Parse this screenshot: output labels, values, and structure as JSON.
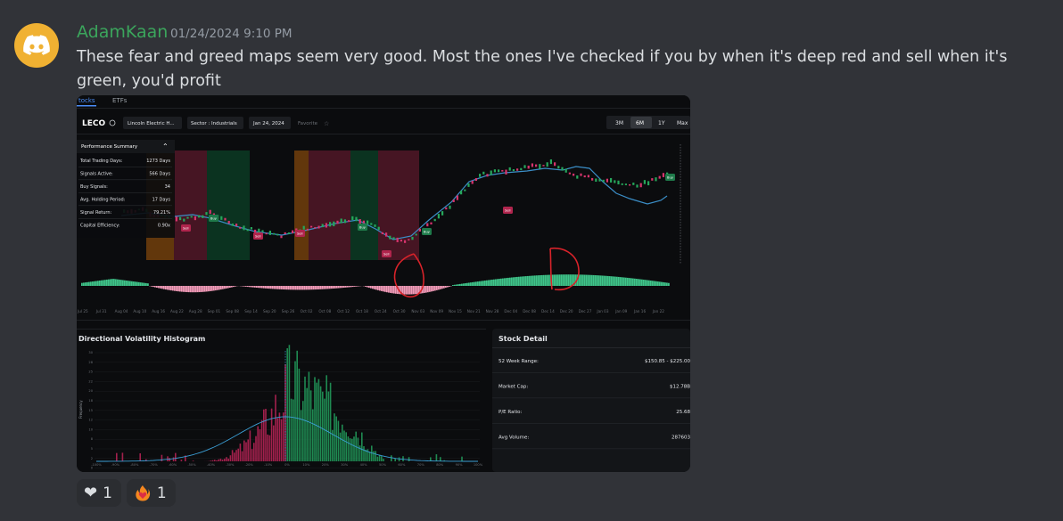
{
  "message": {
    "username": "AdamKaan",
    "timestamp": "01/24/2024 9:10 PM",
    "content": "These fear and greed maps seem very good.  Most the ones I've checked if you by when it's deep red and sell when it's green, you'd profit"
  },
  "reactions": [
    {
      "emoji": "heart",
      "count": "1"
    },
    {
      "emoji": "fire-heart",
      "count": "1"
    }
  ],
  "screenshot": {
    "tabs": [
      "tocks",
      "ETFs"
    ],
    "ticker": "LECO",
    "company_chip": "Lincoln Electric H...",
    "sector_chip": "Sector : Industrials",
    "date_chip": "Jan 24, 2024",
    "favorite_label": "Favorite",
    "ranges": [
      "3M",
      "6M",
      "1Y",
      "Max"
    ],
    "selected_range": "6M",
    "performance": {
      "title": "Performance Summary",
      "rows": [
        {
          "label": "Total Trading Days:",
          "value": "1273 Days"
        },
        {
          "label": "Signals Active:",
          "value": "566 Days"
        },
        {
          "label": "Buy Signals:",
          "value": "34"
        },
        {
          "label": "Avg. Holding Period:",
          "value": "17 Days"
        },
        {
          "label": "Signal Return:",
          "value": "79.21%"
        },
        {
          "label": "Capital Efficiency:",
          "value": "0.90x"
        }
      ]
    },
    "x_dates": [
      "Jul 25",
      "Jul 31",
      "Aug 04",
      "Aug 10",
      "Aug 16",
      "Aug 22",
      "Aug 28",
      "Sep 01",
      "Sep 08",
      "Sep 14",
      "Sep 20",
      "Sep 26",
      "Oct 02",
      "Oct 08",
      "Oct 12",
      "Oct 18",
      "Oct 24",
      "Oct 30",
      "Nov 03",
      "Nov 09",
      "Nov 15",
      "Nov 21",
      "Nov 28",
      "Dec 04",
      "Dec 08",
      "Dec 14",
      "Dec 20",
      "Dec 27",
      "Jan 03",
      "Jan 09",
      "Jan 16",
      "Jan 22"
    ],
    "signal_labels": {
      "sell": "Sell",
      "buy": "Buy"
    },
    "histogram": {
      "title": "Directional Volatility Histogram",
      "y_label": "Frequency",
      "y_ticks": [
        "30",
        "28",
        "25",
        "22",
        "20",
        "18",
        "15",
        "12",
        "10",
        "8",
        "5",
        "2",
        "0"
      ],
      "x_ticks": [
        "-100%",
        "-90%",
        "-80%",
        "-70%",
        "-60%",
        "-50%",
        "-40%",
        "-30%",
        "-20%",
        "-10%",
        "0%",
        "10%",
        "20%",
        "30%",
        "40%",
        "50%",
        "60%",
        "70%",
        "80%",
        "90%",
        "100%"
      ]
    },
    "stock_detail": {
      "title": "Stock Detail",
      "rows": [
        {
          "label": "52 Week Range:",
          "value": "$150.85 - $225.00"
        },
        {
          "label": "Market Cap:",
          "value": "$12.78B"
        },
        {
          "label": "P/E Ratio:",
          "value": "25.68"
        },
        {
          "label": "Avg Volume:",
          "value": "287603"
        }
      ]
    }
  }
}
